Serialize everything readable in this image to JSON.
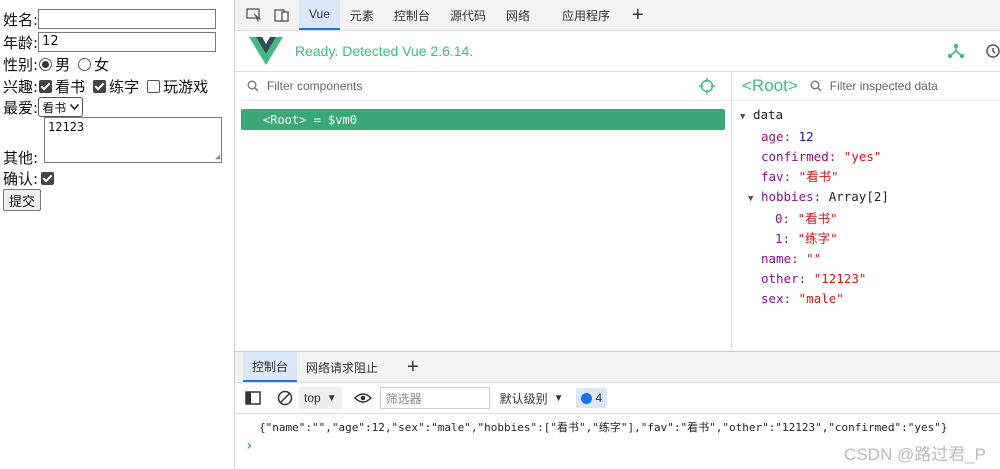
{
  "form": {
    "name_label": "姓名:",
    "name_value": "",
    "age_label": "年龄:",
    "age_value": "12",
    "sex_label": "性别:",
    "sex_options": [
      "男",
      "女"
    ],
    "hobby_label": "兴趣:",
    "hobbies": [
      {
        "label": "看书",
        "checked": true
      },
      {
        "label": "练字",
        "checked": true
      },
      {
        "label": "玩游戏",
        "checked": false
      }
    ],
    "fav_label": "最爱:",
    "fav_value": "看书",
    "other_label": "其他:",
    "other_value": "12123",
    "confirm_label": "确认:",
    "submit_label": "提交"
  },
  "devtools": {
    "tabs": [
      "Vue",
      "元素",
      "控制台",
      "源代码",
      "网络",
      "应用程序"
    ],
    "vue_status": "Ready. Detected Vue 2.6.14.",
    "filter_components": "Filter components",
    "root_selected": "<Root> = $vm0",
    "inspect_title": "<Root>",
    "filter_inspected": "Filter inspected data",
    "data_label": "data",
    "data": {
      "age_key": "age:",
      "age_val": "12",
      "confirmed_key": "confirmed:",
      "confirmed_val": "\"yes\"",
      "fav_key": "fav:",
      "fav_val": "\"看书\"",
      "hobbies_key": "hobbies:",
      "hobbies_val": "Array[2]",
      "h0_key": "0:",
      "h0_val": "\"看书\"",
      "h1_key": "1:",
      "h1_val": "\"练字\"",
      "name_key": "name:",
      "name_val": "\"\"",
      "other_key": "other:",
      "other_val": "\"12123\"",
      "sex_key": "sex:",
      "sex_val": "\"male\""
    }
  },
  "console": {
    "tabs": [
      "控制台",
      "网络请求阻止"
    ],
    "context": "top",
    "filter_placeholder": "筛选器",
    "level": "默认级别",
    "badge_count": "4",
    "output": "{\"name\":\"\",\"age\":12,\"sex\":\"male\",\"hobbies\":[\"看书\",\"练字\"],\"fav\":\"看书\",\"other\":\"12123\",\"confirmed\":\"yes\"}",
    "prompt": "›"
  },
  "watermark": "CSDN @路过君_P",
  "colors": {
    "vue_green": "#42b883",
    "selected_row": "#3ba776",
    "accent_blue": "#1a73e8"
  }
}
